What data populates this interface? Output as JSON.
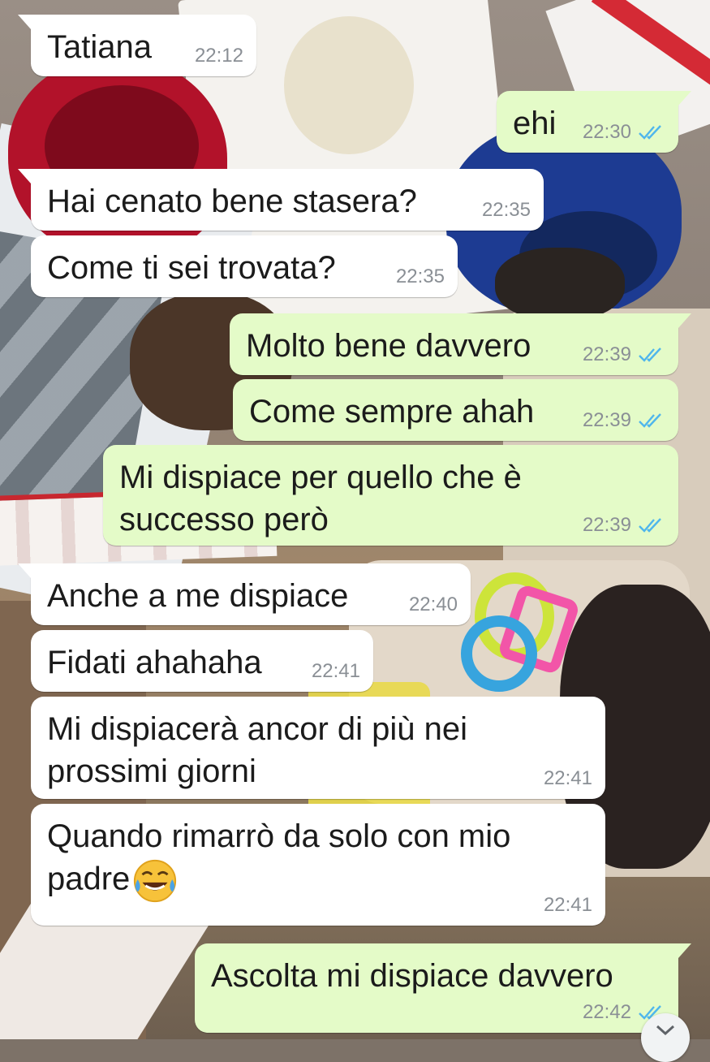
{
  "chat": {
    "messages": [
      {
        "direction": "incoming",
        "text": "Tatiana",
        "time": "22:12"
      },
      {
        "direction": "outgoing",
        "text": "ehi",
        "time": "22:30",
        "status": "read"
      },
      {
        "direction": "incoming",
        "text": "Hai cenato bene stasera?",
        "time": "22:35"
      },
      {
        "direction": "incoming",
        "text": "Come ti sei trovata?",
        "time": "22:35"
      },
      {
        "direction": "outgoing",
        "text": "Molto bene davvero",
        "time": "22:39",
        "status": "read"
      },
      {
        "direction": "outgoing",
        "text": "Come sempre ahah",
        "time": "22:39",
        "status": "read"
      },
      {
        "direction": "outgoing",
        "text": "Mi dispiace per quello che è\nsuccesso però",
        "time": "22:39",
        "status": "read"
      },
      {
        "direction": "incoming",
        "text": "Anche a me dispiace",
        "time": "22:40"
      },
      {
        "direction": "incoming",
        "text": "Fidati ahahaha",
        "time": "22:41"
      },
      {
        "direction": "incoming",
        "text": "Mi dispiacerà ancor di più nei\nprossimi giorni",
        "time": "22:41"
      },
      {
        "direction": "incoming",
        "text": "Quando rimarrò da solo con mio\npadre",
        "time": "22:41",
        "emoji": "face-with-tears-of-joy-icon"
      },
      {
        "direction": "outgoing",
        "text": "Ascolta mi dispiace davvero",
        "time": "22:42",
        "status": "read"
      }
    ]
  },
  "colors": {
    "incoming_bubble": "#ffffff",
    "outgoing_bubble": "#e4fbc8",
    "timestamp": "#8a8f95",
    "read_ticks": "#4fb6ec"
  },
  "icons": {
    "read_receipt": "double-check-icon",
    "scroll_down": "chevron-down-icon"
  }
}
